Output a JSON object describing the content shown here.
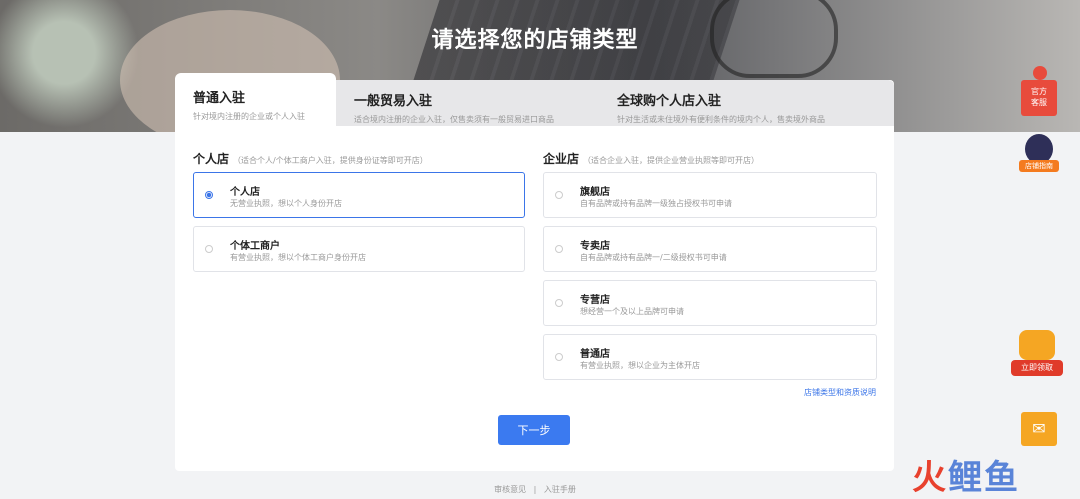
{
  "page": {
    "title": "请选择您的店铺类型"
  },
  "tabs": [
    {
      "label": "普通入驻",
      "sub": "针对境内注册的企业或个人入驻"
    },
    {
      "label": "一般贸易入驻",
      "sub": "适合境内注册的企业入驻，仅售卖须有一般贸易进口商品"
    },
    {
      "label": "全球购个人店入驻",
      "sub": "针对生活或未住境外有便利条件的境内个人，售卖境外商品"
    }
  ],
  "personal": {
    "title": "个人店",
    "hint": "（适合个人/个体工商户入驻，提供身份证等即可开店）",
    "options": [
      {
        "label": "个人店",
        "sub": "无营业执照，想以个人身份开店"
      },
      {
        "label": "个体工商户",
        "sub": "有营业执照，想以个体工商户身份开店"
      }
    ]
  },
  "enterprise": {
    "title": "企业店",
    "hint": "（适合企业入驻，提供企业营业执照等即可开店）",
    "options": [
      {
        "label": "旗舰店",
        "sub": "自有品牌或持有品牌一级独占授权书可申请"
      },
      {
        "label": "专卖店",
        "sub": "自有品牌或持有品牌一/二级授权书可申请"
      },
      {
        "label": "专营店",
        "sub": "想经营一个及以上品牌可申请"
      },
      {
        "label": "普通店",
        "sub": "有营业执照，想以企业为主体开店"
      }
    ]
  },
  "link_label": "店铺类型和资质说明",
  "next_label": "下一步",
  "footer": {
    "left": "审核意见",
    "sep": "|",
    "right": "入驻手册"
  },
  "side": {
    "cs_line1": "官方",
    "cs_line2": "客服",
    "rocket_label": "店铺指南",
    "gift_label": "立即领取"
  },
  "watermark": {
    "part1": "火",
    "part2": "鲤鱼"
  },
  "colors": {
    "accent": "#3b7af0",
    "red": "#e84b3c",
    "orange": "#f5a623"
  }
}
